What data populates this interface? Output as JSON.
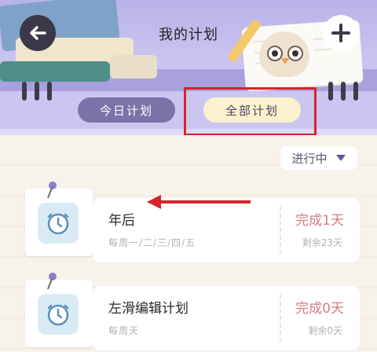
{
  "header": {
    "title": "我的计划",
    "back_icon": "arrow-left-icon",
    "add_icon": "plus-icon"
  },
  "tabs": [
    {
      "label": "今日计划",
      "active": false
    },
    {
      "label": "全部计划",
      "active": true
    }
  ],
  "filter": {
    "label": "进行中",
    "icon": "caret-down-icon"
  },
  "plans": [
    {
      "name": "年后",
      "schedule": "每周一/二/三/四/五",
      "status": "完成1天",
      "remaining": "剩余23天"
    },
    {
      "name": "左滑编辑计划",
      "schedule": "每周天",
      "status": "完成0天",
      "remaining": "剩余0天"
    }
  ],
  "colors": {
    "accent_red": "#d3242a",
    "status_pink": "#d57d86",
    "tab_active_bg": "#fbf1cf",
    "tab_inactive_bg": "#7a73a8"
  }
}
